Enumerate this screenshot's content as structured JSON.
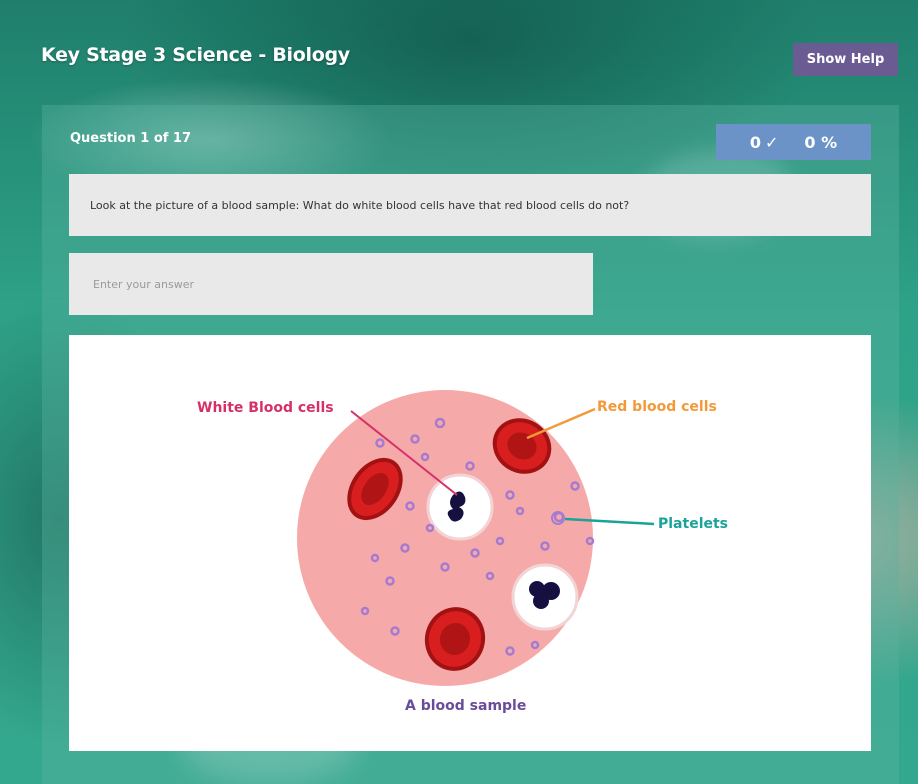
{
  "app": {
    "title": "Key Stage 3 Science - Biology"
  },
  "header": {
    "help_label": "Show Help"
  },
  "quiz": {
    "counter": "Question 1 of 17",
    "score_correct": "0",
    "score_check_icon": "check-icon",
    "score_percent": "0 %"
  },
  "question": {
    "text": "Look at the picture of a blood sample: What do white blood cells have that red blood cells do not?"
  },
  "answer": {
    "placeholder": "Enter your answer",
    "value": ""
  },
  "diagram": {
    "label_white": "White Blood cells",
    "label_red": "Red blood cells",
    "label_platelets": "Platelets",
    "caption": "A blood sample",
    "colors": {
      "white_label": "#d6306b",
      "red_label": "#f29a3a",
      "platelets_label": "#1aa39a",
      "caption": "#6a4d9a",
      "plasma": "#f6a9a9",
      "red_cell": "#d81e1e",
      "nucleus": "#151040",
      "platelet": "#a57bd0"
    }
  },
  "colors": {
    "help_button": "#6a5c93",
    "score_badge": "#6b93c8",
    "input_bg": "#e9e9e9"
  }
}
